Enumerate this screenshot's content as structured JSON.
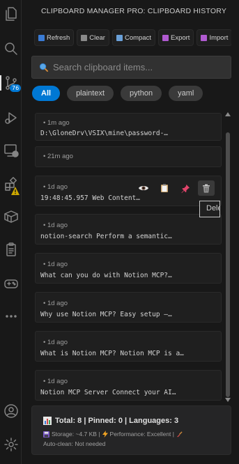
{
  "activity_bar": {
    "source_control_badge": "76",
    "icons": [
      "explorer-icon",
      "search-icon",
      "source-control-icon",
      "run-debug-icon",
      "remote-explorer-icon",
      "extensions-icon",
      "box-icon",
      "clipboard-icon",
      "gamepad-icon",
      "more-icon",
      "account-icon",
      "settings-icon"
    ]
  },
  "panel": {
    "title": "CLIPBOARD MANAGER PRO: CLIPBOARD HISTORY",
    "toolbar": {
      "refresh": "Refresh",
      "clear": "Clear",
      "compact": "Compact",
      "export": "Export",
      "import": "Import"
    },
    "search": {
      "placeholder": "Search clipboard items..."
    },
    "filters": [
      "All",
      "plaintext",
      "python",
      "yaml"
    ],
    "active_filter": "All",
    "items": [
      {
        "time": "1m ago",
        "content": "D:\\GloneDrv\\VSIX\\mine\\password-…"
      },
      {
        "time": "21m ago",
        "content": ""
      },
      {
        "time": "1d ago",
        "content": "19:48:45.957 Web Content…"
      },
      {
        "time": "1d ago",
        "content": "notion-search Perform a semantic…"
      },
      {
        "time": "1d ago",
        "content": "What can you do with Notion MCP?…"
      },
      {
        "time": "1d ago",
        "content": "Why use Notion MCP? Easy setup —…"
      },
      {
        "time": "1d ago",
        "content": "What is Notion MCP? Notion MCP is a…"
      },
      {
        "time": "1d ago",
        "content": "Notion MCP Server Connect your AI…"
      }
    ],
    "item_actions": [
      "preview-icon",
      "copy-icon",
      "pin-icon",
      "delete-icon"
    ],
    "tooltip": "Delete",
    "footer": {
      "stats": "Total: 8 | Pinned: 0 | Languages: 3",
      "storage": "Storage: ~4.7 KB |",
      "performance": "Performance: Excellent |",
      "autoclean": "Auto-clean: Not needed"
    }
  },
  "colors": {
    "accent": "#0078d4",
    "background": "#181818",
    "card": "#1f1f1f",
    "pin": "#e0446a"
  }
}
